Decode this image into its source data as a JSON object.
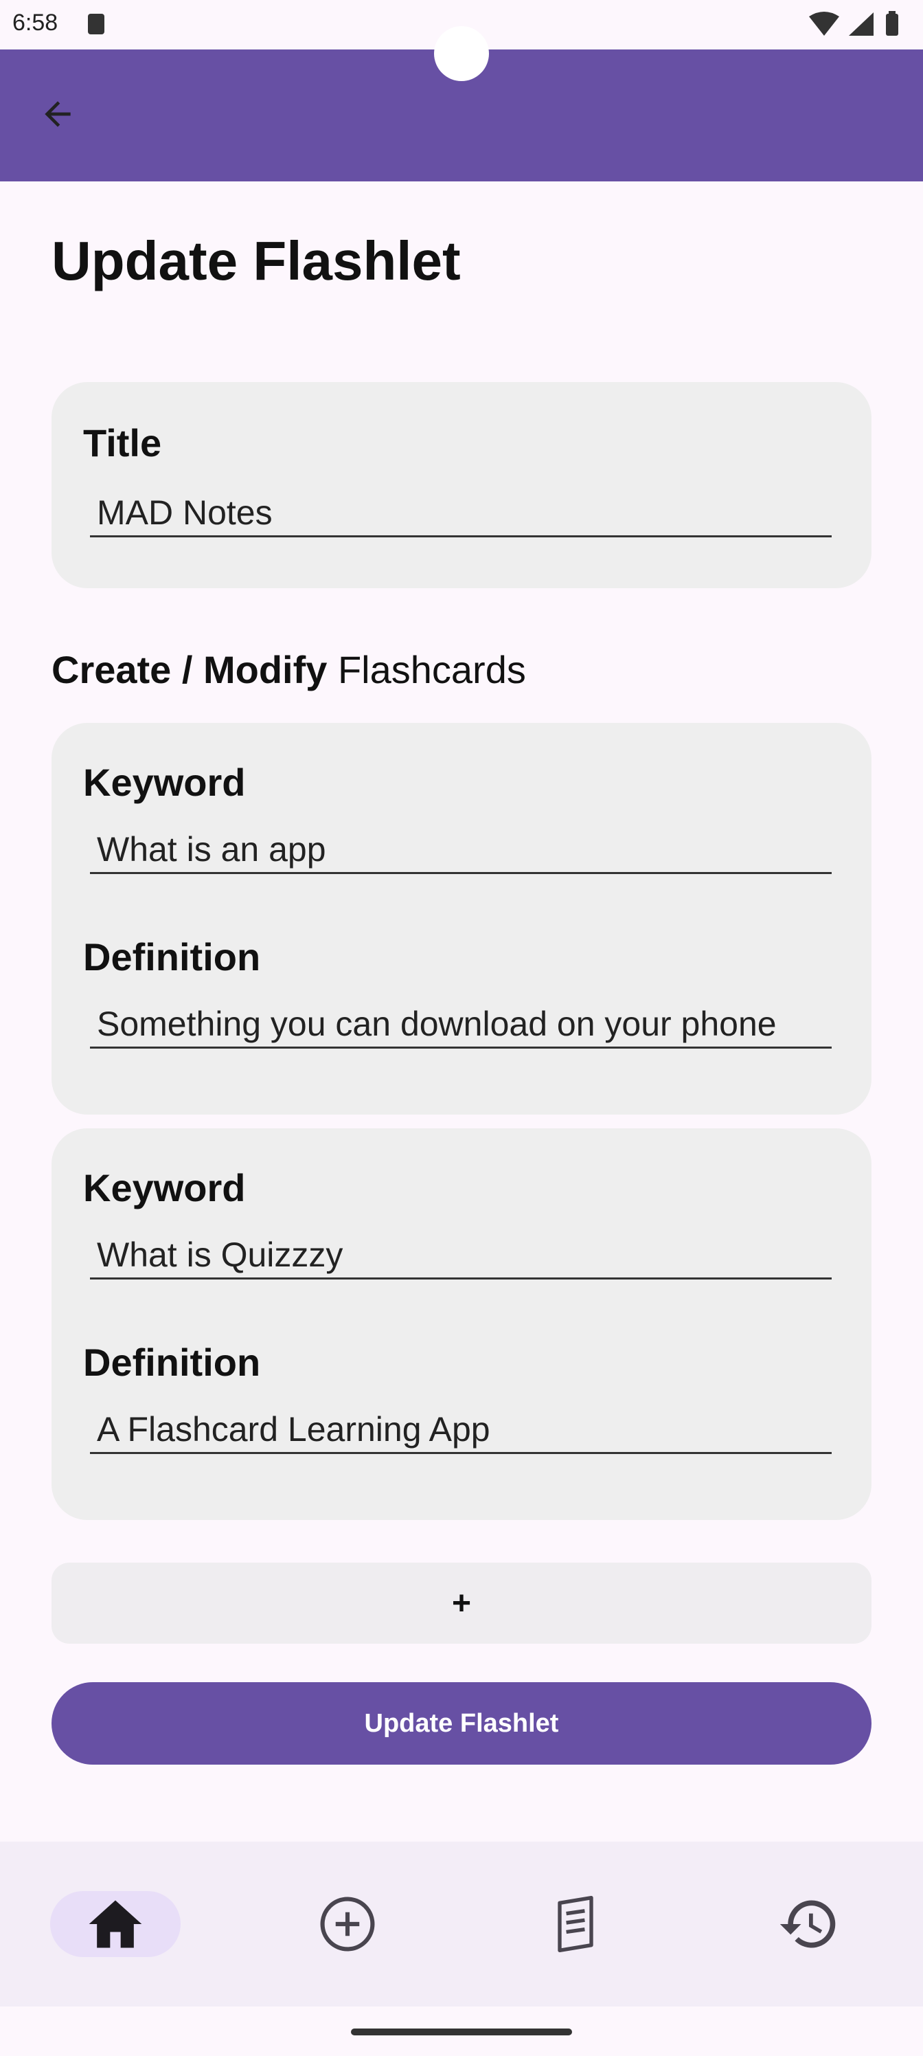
{
  "status_bar": {
    "time": "6:58"
  },
  "app_bar": {
    "back_icon": "arrow-back-icon"
  },
  "page": {
    "title": "Update Flashlet"
  },
  "title_card": {
    "label": "Title",
    "value": "MAD Notes"
  },
  "flashcards_section": {
    "heading_bold": "Create / Modify",
    "heading_regular": " Flashcards"
  },
  "flashcards": [
    {
      "keyword_label": "Keyword",
      "keyword_value": "What is an app",
      "definition_label": "Definition",
      "definition_value": "Something you can download on your phone"
    },
    {
      "keyword_label": "Keyword",
      "keyword_value": "What is Quizzzy",
      "definition_label": "Definition",
      "definition_value": "A Flashcard Learning App"
    }
  ],
  "actions": {
    "add_label": "+",
    "update_label": "Update Flashlet"
  },
  "bottom_nav": {
    "items": [
      {
        "icon": "home-icon",
        "selected": true
      },
      {
        "icon": "add-circle-icon",
        "selected": false
      },
      {
        "icon": "library-icon",
        "selected": false
      },
      {
        "icon": "history-icon",
        "selected": false
      }
    ]
  },
  "colors": {
    "primary": "#6750a4",
    "background": "#fdf7fd",
    "card": "#eeeeee",
    "nav_background": "#f3edf7",
    "nav_indicator": "#e8def8"
  }
}
